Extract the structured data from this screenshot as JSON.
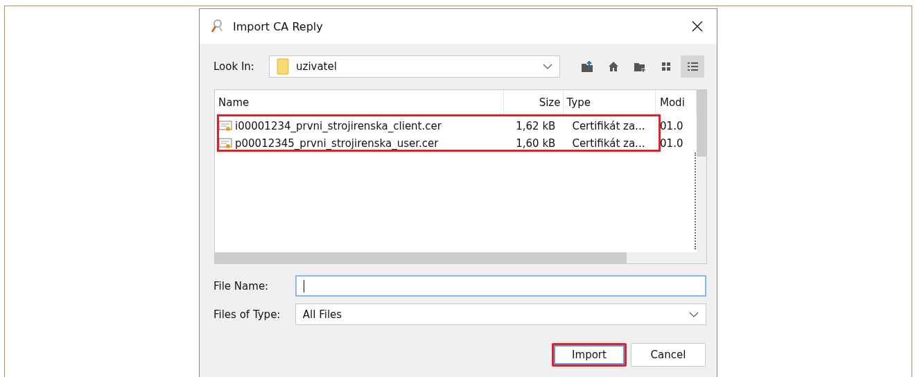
{
  "window": {
    "title": "Import CA Reply"
  },
  "look_in": {
    "label": "Look In:",
    "value": "uzivatel"
  },
  "toolbar": [
    {
      "kind": "up",
      "selected": false
    },
    {
      "kind": "home",
      "selected": false
    },
    {
      "kind": "new-folder",
      "selected": false
    },
    {
      "kind": "list",
      "selected": false
    },
    {
      "kind": "details",
      "selected": true
    }
  ],
  "file_list": {
    "columns": [
      "Name",
      "Size",
      "Type",
      "Modi"
    ],
    "highlighted": true,
    "rows": [
      {
        "name": "i00001234_prvni_strojirenska_client.cer",
        "size": "1,62 kB",
        "type": "Certifikát za...",
        "modified": "01.0",
        "selected": false
      },
      {
        "name": "p00012345_prvni_strojirenska_user.cer",
        "size": "1,60 kB",
        "type": "Certifikát za...",
        "modified": "01.0",
        "selected": false
      }
    ]
  },
  "file_name": {
    "label": "File Name:"
  },
  "file_type": {
    "label": "Files of Type:",
    "value": "All Files"
  },
  "buttons": [
    {
      "label": "Import",
      "highlighted": true
    },
    {
      "label": "Cancel",
      "highlighted": false
    }
  ]
}
